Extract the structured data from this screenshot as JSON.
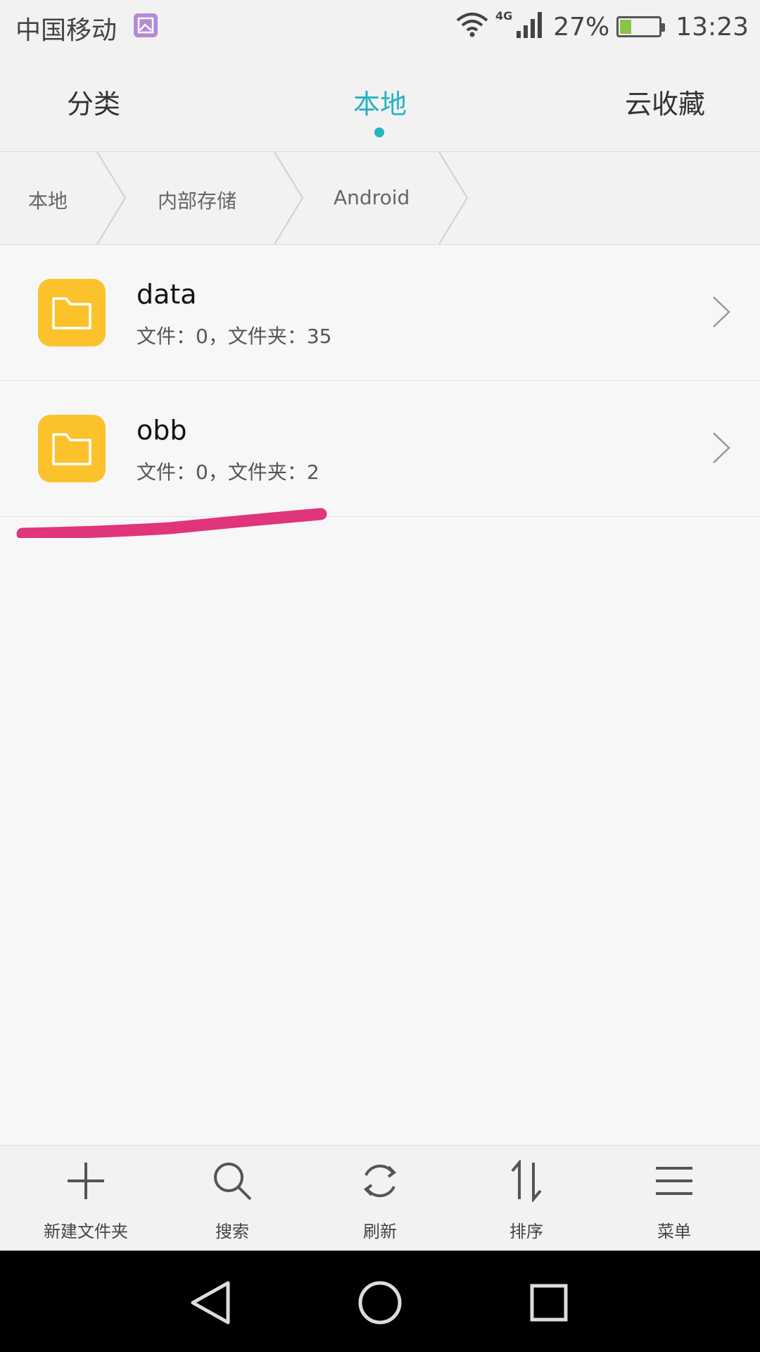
{
  "status_bar": {
    "carrier": "中国移动",
    "network": "4G",
    "battery_percent": "27%",
    "battery_level": 0.27,
    "time": "13:23",
    "icons": [
      "gallery-notification-icon",
      "wifi-icon",
      "signal-icon",
      "battery-charging-icon"
    ]
  },
  "tabs": [
    {
      "label": "分类",
      "active": false
    },
    {
      "label": "本地",
      "active": true
    },
    {
      "label": "云收藏",
      "active": false
    }
  ],
  "breadcrumb": [
    "本地",
    "内部存储",
    "Android"
  ],
  "folders": [
    {
      "name": "data",
      "meta": "文件：0，文件夹：35",
      "icon": "folder-icon"
    },
    {
      "name": "obb",
      "meta": "文件：0，文件夹：2",
      "icon": "folder-icon"
    }
  ],
  "toolbar": [
    {
      "label": "新建文件夹",
      "icon": "plus-icon"
    },
    {
      "label": "搜索",
      "icon": "search-icon"
    },
    {
      "label": "刷新",
      "icon": "refresh-icon"
    },
    {
      "label": "排序",
      "icon": "sort-icon"
    },
    {
      "label": "菜单",
      "icon": "menu-icon"
    }
  ],
  "colors": {
    "accent": "#26b3c2",
    "folder": "#fcc22c",
    "annotation": "#e0357a"
  }
}
